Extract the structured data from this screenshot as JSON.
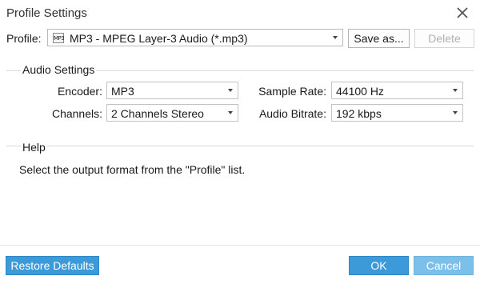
{
  "window": {
    "title": "Profile Settings"
  },
  "profile": {
    "label": "Profile:",
    "format_icon_text": "MP3",
    "selected": "MP3 - MPEG Layer-3 Audio (*.mp3)",
    "save_label": "Save as...",
    "delete_label": "Delete"
  },
  "audio": {
    "section_title": "Audio Settings",
    "encoder_label": "Encoder:",
    "encoder_value": "MP3",
    "channels_label": "Channels:",
    "channels_value": "2 Channels Stereo",
    "sample_rate_label": "Sample Rate:",
    "sample_rate_value": "44100 Hz",
    "bitrate_label": "Audio Bitrate:",
    "bitrate_value": "192 kbps"
  },
  "help": {
    "section_title": "Help",
    "text": "Select the output format from the \"Profile\" list."
  },
  "footer": {
    "restore_label": "Restore Defaults",
    "ok_label": "OK",
    "cancel_label": "Cancel"
  },
  "colors": {
    "primary_button": "#3d9ad9",
    "secondary_button": "#7cc0ea"
  }
}
